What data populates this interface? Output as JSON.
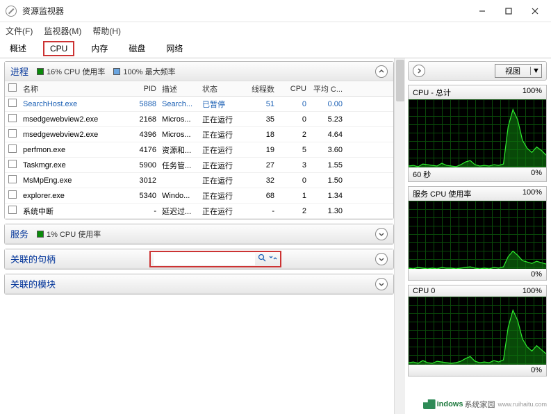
{
  "window": {
    "title": "资源监视器"
  },
  "menu": {
    "file": "文件(F)",
    "monitor": "监视器(M)",
    "help": "帮助(H)"
  },
  "tabs": {
    "overview": "概述",
    "cpu": "CPU",
    "memory": "内存",
    "disk": "磁盘",
    "network": "网络"
  },
  "processes": {
    "title": "进程",
    "cpu_usage": "16% CPU 使用率",
    "max_freq": "100% 最大频率",
    "cols": {
      "name": "名称",
      "pid": "PID",
      "desc": "描述",
      "state": "状态",
      "threads": "线程数",
      "cpu": "CPU",
      "avg": "平均 C..."
    },
    "rows": [
      {
        "name": "SearchHost.exe",
        "pid": "5888",
        "desc": "Search...",
        "state": "已暂停",
        "threads": "51",
        "cpu": "0",
        "avg": "0.00",
        "blue": true
      },
      {
        "name": "msedgewebview2.exe",
        "pid": "2168",
        "desc": "Micros...",
        "state": "正在运行",
        "threads": "35",
        "cpu": "0",
        "avg": "5.23"
      },
      {
        "name": "msedgewebview2.exe",
        "pid": "4396",
        "desc": "Micros...",
        "state": "正在运行",
        "threads": "18",
        "cpu": "2",
        "avg": "4.64"
      },
      {
        "name": "perfmon.exe",
        "pid": "4176",
        "desc": "资源和...",
        "state": "正在运行",
        "threads": "19",
        "cpu": "5",
        "avg": "3.60"
      },
      {
        "name": "Taskmgr.exe",
        "pid": "5900",
        "desc": "任务管...",
        "state": "正在运行",
        "threads": "27",
        "cpu": "3",
        "avg": "1.55"
      },
      {
        "name": "MsMpEng.exe",
        "pid": "3012",
        "desc": "",
        "state": "正在运行",
        "threads": "32",
        "cpu": "0",
        "avg": "1.50"
      },
      {
        "name": "explorer.exe",
        "pid": "5340",
        "desc": "Windo...",
        "state": "正在运行",
        "threads": "68",
        "cpu": "1",
        "avg": "1.34"
      },
      {
        "name": "系统中断",
        "pid": "-",
        "desc": "延迟过...",
        "state": "正在运行",
        "threads": "-",
        "cpu": "2",
        "avg": "1.30"
      }
    ]
  },
  "services": {
    "title": "服务",
    "cpu_usage": "1% CPU 使用率"
  },
  "handles": {
    "title": "关联的句柄"
  },
  "modules": {
    "title": "关联的模块"
  },
  "right": {
    "view": "视图",
    "g1": {
      "title": "CPU - 总计",
      "max": "100%",
      "footer_l": "60 秒",
      "footer_r": "0%"
    },
    "g2": {
      "title": "服务 CPU 使用率",
      "max": "100%",
      "footer_r": "0%"
    },
    "g3": {
      "title": "CPU 0",
      "max": "100%",
      "footer_r": "0%"
    }
  },
  "watermark": {
    "brand": "indows",
    "suffix": "系统家园",
    "sub": "www.ruihaitu.com"
  },
  "chart_data": [
    {
      "type": "area",
      "title": "CPU - 总计",
      "ylabel": "%",
      "ylim": [
        0,
        100
      ],
      "x": "60 秒",
      "series": [
        {
          "name": "cpu_total",
          "values": [
            2,
            3,
            1,
            5,
            4,
            3,
            2,
            6,
            3,
            2,
            1,
            4,
            8,
            10,
            4,
            2,
            3,
            2,
            4,
            3,
            5,
            60,
            85,
            70,
            40,
            28,
            22,
            30,
            25,
            18
          ]
        }
      ]
    },
    {
      "type": "area",
      "title": "服务 CPU 使用率",
      "ylabel": "%",
      "ylim": [
        0,
        100
      ],
      "series": [
        {
          "name": "services_cpu",
          "values": [
            1,
            0,
            2,
            1,
            0,
            1,
            0,
            2,
            1,
            1,
            0,
            1,
            2,
            3,
            1,
            0,
            1,
            0,
            2,
            1,
            3,
            18,
            26,
            20,
            12,
            10,
            8,
            11,
            9,
            7
          ]
        }
      ]
    },
    {
      "type": "area",
      "title": "CPU 0",
      "ylabel": "%",
      "ylim": [
        0,
        100
      ],
      "series": [
        {
          "name": "cpu0",
          "values": [
            3,
            4,
            2,
            6,
            3,
            2,
            5,
            4,
            3,
            2,
            3,
            5,
            9,
            12,
            5,
            3,
            4,
            3,
            6,
            4,
            7,
            55,
            80,
            65,
            38,
            26,
            20,
            28,
            22,
            16
          ]
        }
      ]
    }
  ]
}
